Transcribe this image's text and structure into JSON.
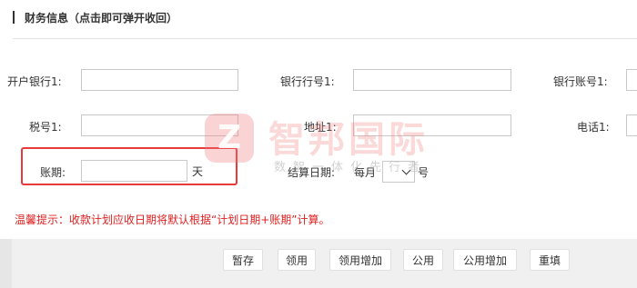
{
  "section": {
    "title": "财务信息（点击即可弹开收回）"
  },
  "fields": {
    "bank_name": {
      "label": "开户银行1:",
      "value": ""
    },
    "bank_code": {
      "label": "银行行号1:",
      "value": ""
    },
    "bank_account": {
      "label": "银行账号1:",
      "value": ""
    },
    "tax_no": {
      "label": "税号1:",
      "value": ""
    },
    "address": {
      "label": "地址1:",
      "value": ""
    },
    "phone": {
      "label": "电话1:",
      "value": ""
    },
    "payment_term": {
      "label": "账期:",
      "value": "",
      "unit": "天"
    },
    "settlement_date": {
      "label": "结算日期:",
      "prefix": "每月",
      "value": "",
      "suffix": "号"
    }
  },
  "tip": "温馨提示：收款计划应收日期将默认根据“计划日期+账期”计算。",
  "buttons": {
    "save_draft": "暂存",
    "use": "领用",
    "use_add": "领用增加",
    "public": "公用",
    "public_add": "公用增加",
    "reset": "重填"
  },
  "watermark": {
    "logo": "Z",
    "name": "智邦国际",
    "slogan": "数智一体化先行者"
  },
  "colors": {
    "alert": "#e02020",
    "highlight_border": "#e83a3a",
    "footer_bg": "#f0f0f0"
  }
}
